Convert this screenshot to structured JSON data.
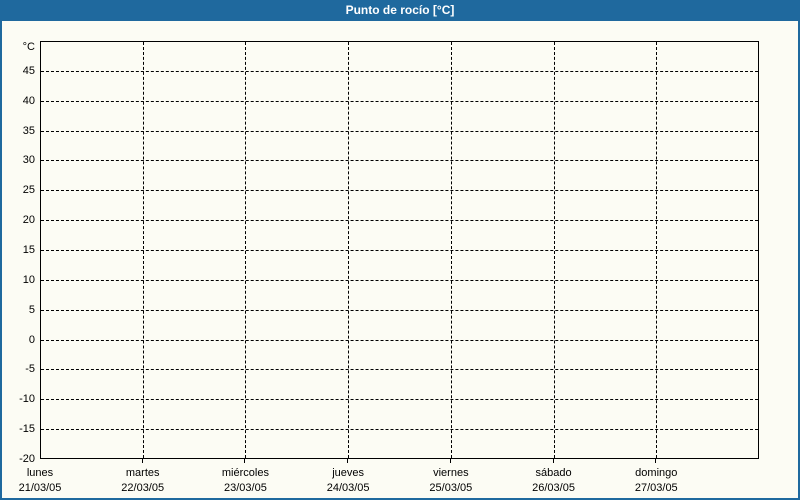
{
  "widget": {
    "title": "Punto de rocío [°C]"
  },
  "colors": {
    "frame_blue": "#1f699e",
    "title_text": "#ffffff",
    "background": "#fcfcf4",
    "grid": "#000000",
    "text": "#000000"
  },
  "chart_data": {
    "type": "line",
    "title": "Punto de rocío [°C]",
    "y_unit_label": "°C",
    "ylabel": "°C",
    "xlabel": "",
    "ylim": [
      -20,
      50
    ],
    "ytick_step": 5,
    "yticks": [
      45,
      40,
      35,
      30,
      25,
      20,
      15,
      10,
      5,
      0,
      -5,
      -10,
      -15,
      -20
    ],
    "categories": [
      {
        "day": "lunes",
        "date": "21/03/05"
      },
      {
        "day": "martes",
        "date": "22/03/05"
      },
      {
        "day": "miércoles",
        "date": "23/03/05"
      },
      {
        "day": "jueves",
        "date": "24/03/05"
      },
      {
        "day": "viernes",
        "date": "25/03/05"
      },
      {
        "day": "sábado",
        "date": "26/03/05"
      },
      {
        "day": "domingo",
        "date": "27/03/05"
      }
    ],
    "series": [],
    "grid": "dashed",
    "legend": "none"
  }
}
